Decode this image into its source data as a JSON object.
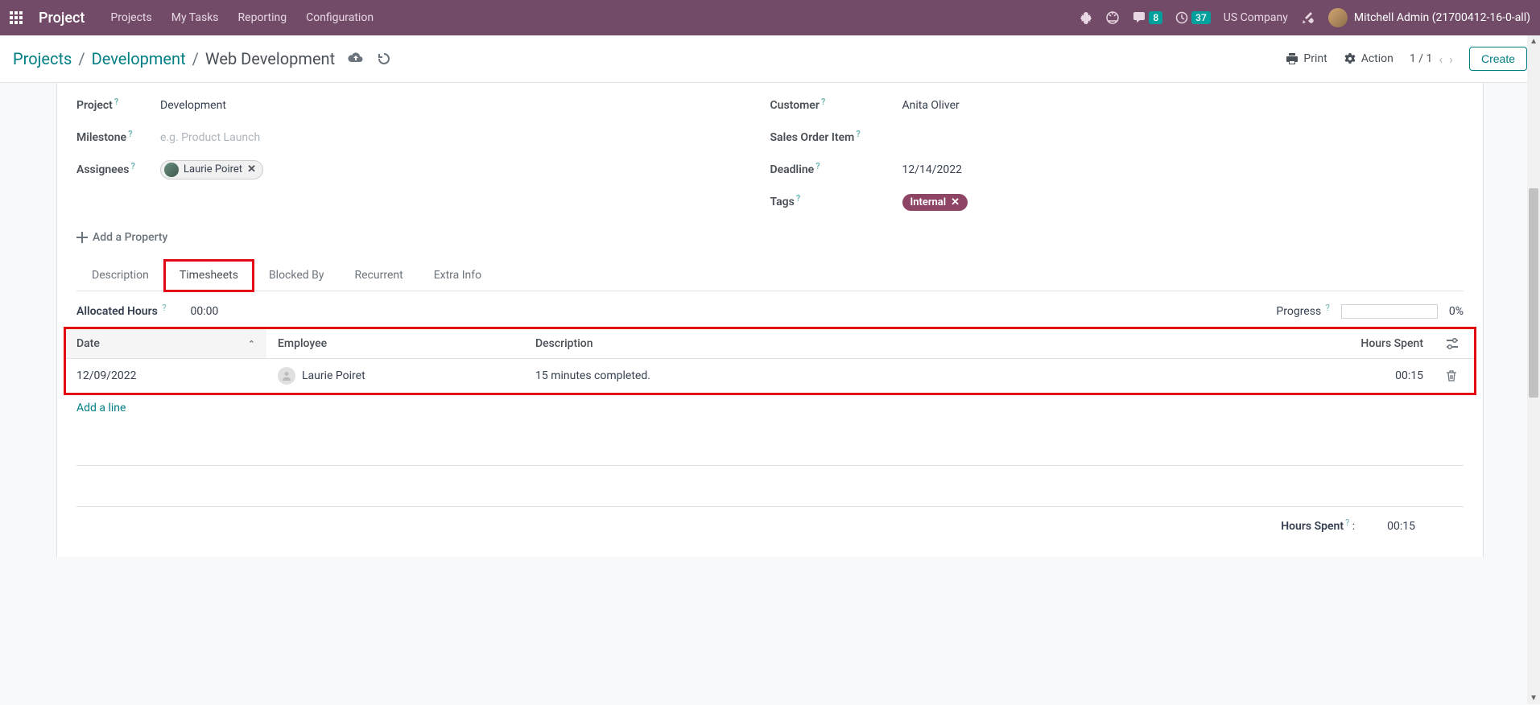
{
  "navbar": {
    "brand": "Project",
    "menu": [
      "Projects",
      "My Tasks",
      "Reporting",
      "Configuration"
    ],
    "messages_badge": "8",
    "activities_badge": "37",
    "company": "US Company",
    "user": "Mitchell Admin (21700412-16-0-all)"
  },
  "controlbar": {
    "breadcrumb": [
      "Projects",
      "Development",
      "Web Development"
    ],
    "print": "Print",
    "action": "Action",
    "pager": "1 / 1",
    "create": "Create"
  },
  "form": {
    "left": {
      "project_label": "Project",
      "project_value": "Development",
      "milestone_label": "Milestone",
      "milestone_placeholder": "e.g. Product Launch",
      "assignees_label": "Assignees",
      "assignee_name": "Laurie Poiret"
    },
    "right": {
      "customer_label": "Customer",
      "customer_value": "Anita Oliver",
      "soi_label": "Sales Order Item",
      "deadline_label": "Deadline",
      "deadline_value": "12/14/2022",
      "tags_label": "Tags",
      "tag_value": "Internal"
    },
    "add_property": "Add a Property"
  },
  "tabs": [
    "Description",
    "Timesheets",
    "Blocked By",
    "Recurrent",
    "Extra Info"
  ],
  "timesheet": {
    "allocated_label": "Allocated Hours",
    "allocated_value": "00:00",
    "progress_label": "Progress",
    "progress_value": "0%",
    "columns": {
      "date": "Date",
      "employee": "Employee",
      "description": "Description",
      "hours": "Hours Spent"
    },
    "rows": [
      {
        "date": "12/09/2022",
        "employee": "Laurie Poiret",
        "description": "15 minutes completed.",
        "hours": "00:15"
      }
    ],
    "add_line": "Add a line",
    "total_label": "Hours Spent",
    "total_value": "00:15"
  }
}
